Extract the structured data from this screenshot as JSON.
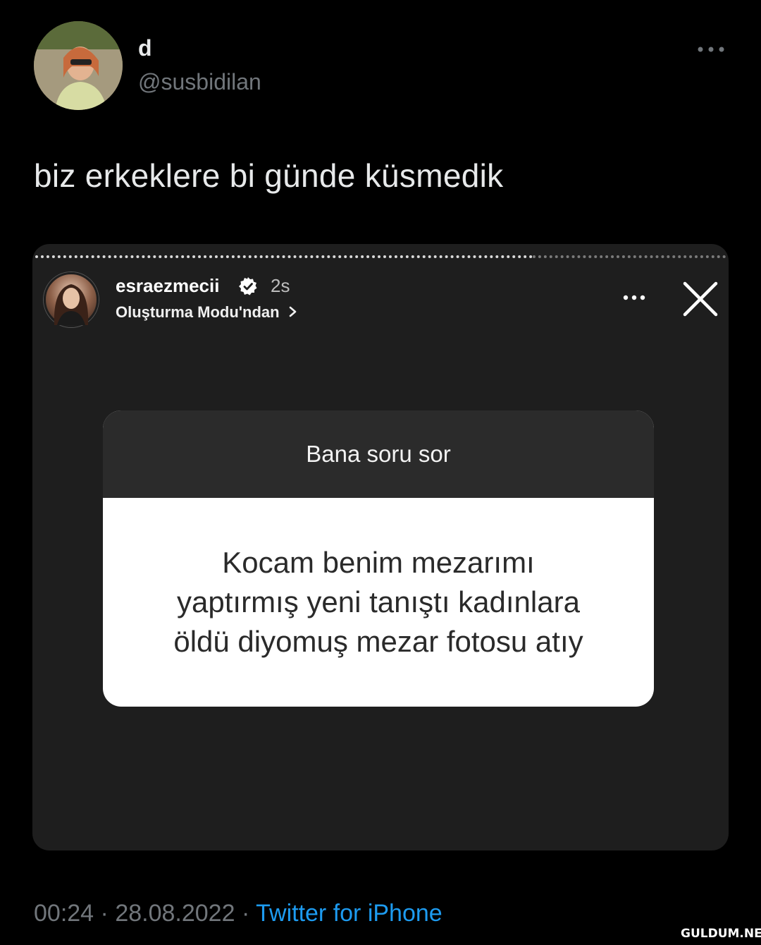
{
  "tweet": {
    "display_name": "d",
    "handle": "@susbidilan",
    "text": "biz erkeklere bi günde küsmedik",
    "time": "00:24",
    "separator": "·",
    "date": "28.08.2022",
    "source": "Twitter for iPhone"
  },
  "story": {
    "username": "esraezmecii",
    "time_ago": "2s",
    "subtitle": "Oluşturma Modu'ndan",
    "question_header": "Bana soru sor",
    "question_lines": [
      "Kocam benim mezarımı",
      "yaptırmış yeni tanıştı kadınlara",
      "öldü diyomuş mezar fotosu atıy"
    ]
  },
  "watermark": "GULDUM.NET",
  "icons": {
    "more": "more-horizontal-icon",
    "verified": "verified-badge-icon",
    "chevron": "chevron-right-icon",
    "close": "close-icon"
  },
  "colors": {
    "background": "#000000",
    "text_primary": "#e7e9ea",
    "text_secondary": "#71767b",
    "link": "#1d9bf0",
    "story_bg": "#1e1e1e"
  }
}
